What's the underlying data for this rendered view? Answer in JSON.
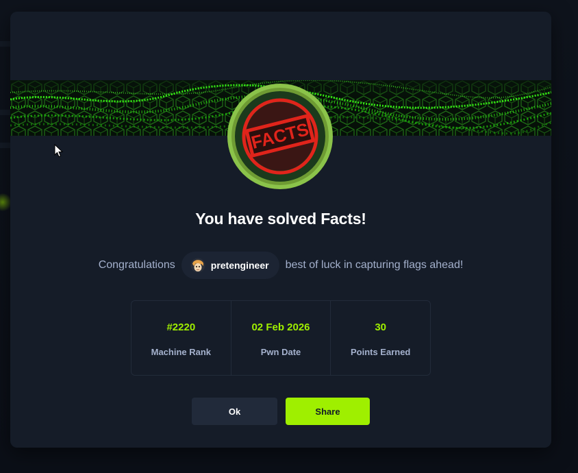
{
  "modal": {
    "badge_text": "FACTS",
    "title": "You have solved Facts!",
    "congrats_prefix": "Congratulations",
    "username": "pretengineer",
    "congrats_suffix": "best of luck in capturing flags ahead!",
    "stats": [
      {
        "value": "#2220",
        "label": "Machine Rank"
      },
      {
        "value": "02 Feb 2026",
        "label": "Pwn Date"
      },
      {
        "value": "30",
        "label": "Points Earned"
      }
    ],
    "buttons": {
      "ok": "Ok",
      "share": "Share"
    }
  },
  "colors": {
    "accent": "#9fef00",
    "modal_bg": "#151c28",
    "secondary_text": "#a4b1cd",
    "badge_red": "#e0241b"
  },
  "icons": {
    "banner": "green-wave-banner",
    "badge": "facts-machine-badge",
    "avatar": "user-avatar-icon",
    "cursor": "mouse-pointer-icon"
  }
}
